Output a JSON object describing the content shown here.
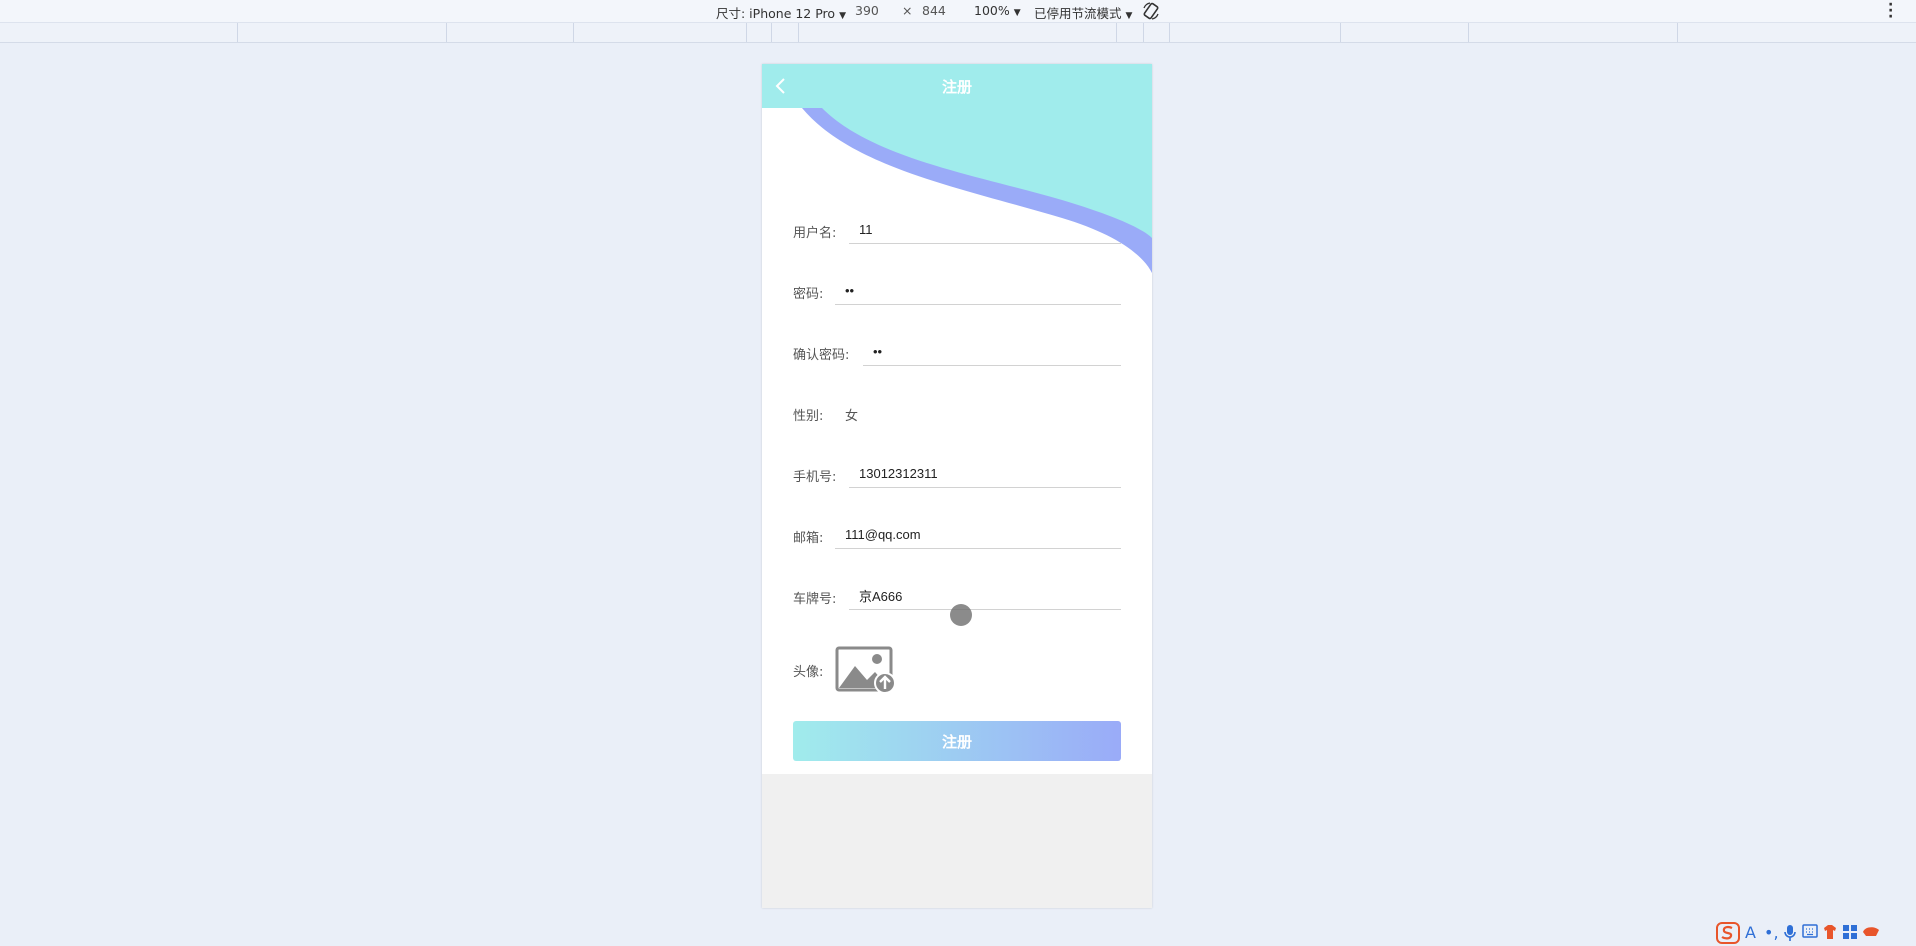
{
  "devtools": {
    "size_label": "尺寸: iPhone 12 Pro",
    "width": "390",
    "times": "×",
    "height": "844",
    "zoom": "100%",
    "throttle": "已停用节流模式"
  },
  "page": {
    "title": "注册",
    "fields": {
      "username": {
        "label": "用户名:",
        "value": "11"
      },
      "password": {
        "label": "密码:",
        "value": "11"
      },
      "confirm_password": {
        "label": "确认密码:",
        "value": "11"
      },
      "gender": {
        "label": "性别:",
        "value": "女"
      },
      "phone": {
        "label": "手机号:",
        "value": "13012312311"
      },
      "email": {
        "label": "邮箱:",
        "value": "111@qq.com"
      },
      "plate": {
        "label": "车牌号:",
        "value": "京A666"
      },
      "avatar": {
        "label": "头像:"
      }
    },
    "submit_label": "注册"
  },
  "colors": {
    "header": "#a0ecec",
    "wave": "#9aabf8",
    "button_start": "#a0ecec",
    "button_end": "#9aabf8",
    "background": "#eaeff8"
  },
  "icons": {
    "back": "chevron-left-icon",
    "avatar": "image-upload-icon",
    "rotate": "rotate-device-icon"
  }
}
